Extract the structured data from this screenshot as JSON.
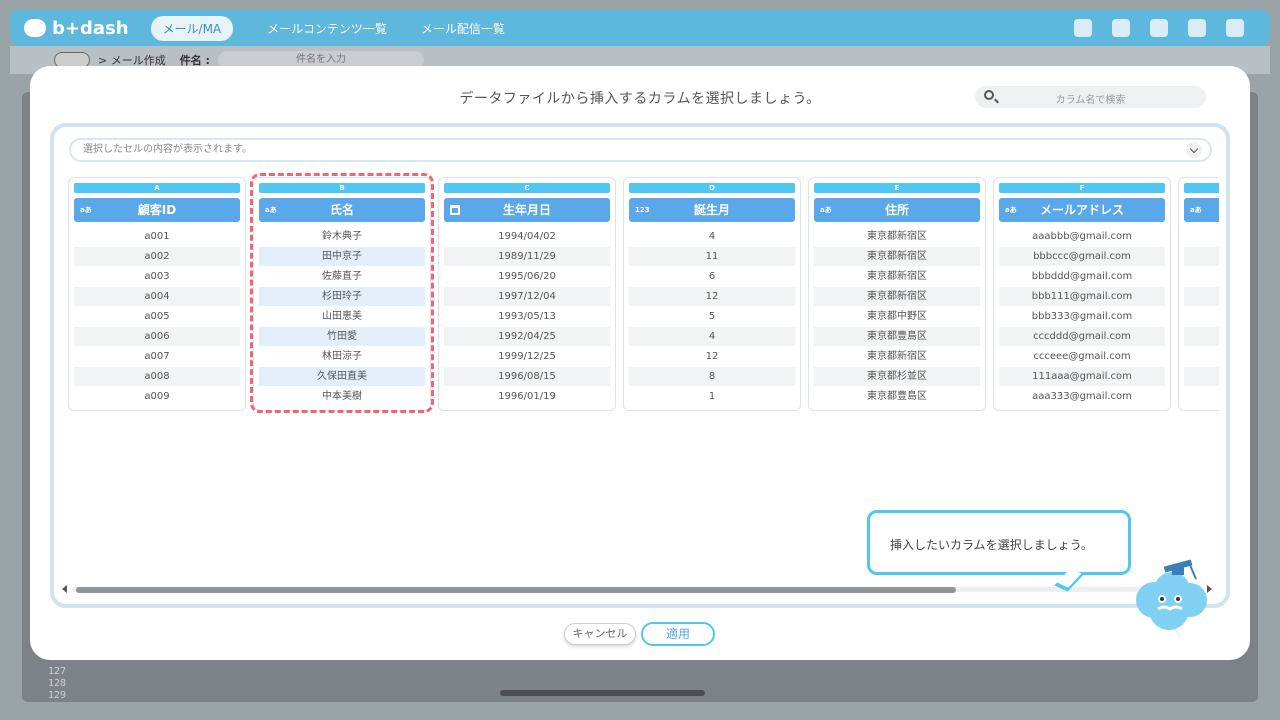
{
  "app": {
    "brand": "b+dash",
    "module_pill": "メール/MA",
    "nav": [
      "メールコンテンツ一覧",
      "メール配信一覧"
    ],
    "breadcrumb": "> メール作成",
    "subject_label": "件名 :",
    "subject_placeholder": "件名を入力",
    "line_numbers": [
      "127",
      "128",
      "129"
    ]
  },
  "modal": {
    "title": "データファイルから挿入するカラムを選択しましょう。",
    "search_placeholder": "カラム名で検索",
    "cell_preview_placeholder": "選択したセルの内容が表示されます。",
    "cancel_label": "キャンセル",
    "apply_label": "適用",
    "tooltip": "挿入したいカラムを選択しましょう。",
    "selected_column": "B"
  },
  "columns": [
    {
      "letter": "A",
      "header": "顧客ID",
      "type_icon": "text-type-icon",
      "type_label": "aあ",
      "rows": [
        "a001",
        "a002",
        "a003",
        "a004",
        "a005",
        "a006",
        "a007",
        "a008",
        "a009"
      ]
    },
    {
      "letter": "B",
      "header": "氏名",
      "type_icon": "text-type-icon",
      "type_label": "aあ",
      "rows": [
        "鈴木典子",
        "田中京子",
        "佐藤直子",
        "杉田玲子",
        "山田恵美",
        "竹田愛",
        "林田涼子",
        "久保田直美",
        "中本美樹"
      ]
    },
    {
      "letter": "C",
      "header": "生年月日",
      "type_icon": "calendar-icon",
      "type_label": "",
      "rows": [
        "1994/04/02",
        "1989/11/29",
        "1995/06/20",
        "1997/12/04",
        "1993/05/13",
        "1992/04/25",
        "1999/12/25",
        "1996/08/15",
        "1996/01/19"
      ]
    },
    {
      "letter": "D",
      "header": "誕生月",
      "type_icon": "number-type-icon",
      "type_label": "123",
      "rows": [
        "4",
        "11",
        "6",
        "12",
        "5",
        "4",
        "12",
        "8",
        "1"
      ]
    },
    {
      "letter": "E",
      "header": "住所",
      "type_icon": "text-type-icon",
      "type_label": "aあ",
      "rows": [
        "東京都新宿区",
        "東京都新宿区",
        "東京都新宿区",
        "東京都新宿区",
        "東京都中野区",
        "東京都豊島区",
        "東京都新宿区",
        "東京都杉並区",
        "東京都豊島区"
      ]
    },
    {
      "letter": "F",
      "header": "メールアドレス",
      "type_icon": "text-type-icon",
      "type_label": "aあ",
      "rows": [
        "aaabbb@gmail.com",
        "bbbccc@gmail.com",
        "bbbddd@gmail.com",
        "bbb111@gmail.com",
        "bbb333@gmail.com",
        "cccddd@gmail.com",
        "ccceee@gmail.com",
        "111aaa@gmail.com",
        "aaa333@gmail.com"
      ]
    },
    {
      "letter": "",
      "header": "",
      "type_icon": "text-type-icon",
      "type_label": "aあ",
      "rows": [
        "",
        "",
        "",
        "",
        "",
        "",
        "",
        "",
        ""
      ]
    }
  ],
  "colors": {
    "accent": "#4fc7f0",
    "header_blue": "#5aa7ea",
    "selection": "#ee6677"
  }
}
